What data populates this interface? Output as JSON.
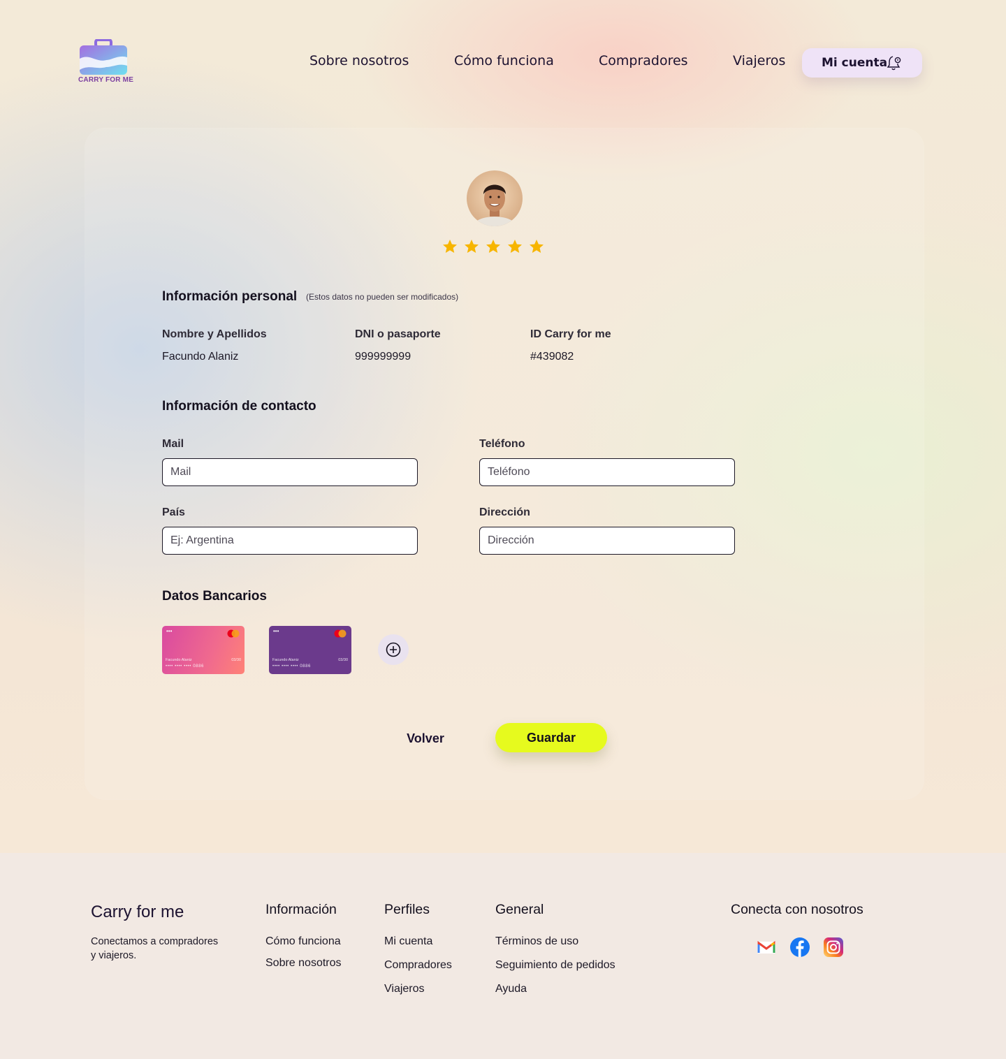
{
  "header": {
    "logo_text": "CARRY FOR ME",
    "nav": [
      "Sobre nosotros",
      "Cómo funciona",
      "Compradores",
      "Viajeros"
    ],
    "account_label": "Mi cuenta"
  },
  "profile": {
    "rating_stars": 5,
    "personal": {
      "title": "Información personal",
      "note": "(Estos datos no pueden ser modificados)",
      "fields": [
        {
          "label": "Nombre y Apellidos",
          "value": "Facundo Alaniz"
        },
        {
          "label": "DNI o pasaporte",
          "value": "999999999"
        },
        {
          "label": "ID Carry for me",
          "value": "#439082"
        }
      ]
    },
    "contact": {
      "title": "Información de contacto",
      "mail": {
        "label": "Mail",
        "placeholder": "Mail"
      },
      "phone": {
        "label": "Teléfono",
        "placeholder": "Teléfono"
      },
      "country": {
        "label": "País",
        "placeholder": "Ej: Argentina"
      },
      "address": {
        "label": "Dirección",
        "placeholder": "Dirección"
      }
    },
    "bank": {
      "title": "Datos Bancarios",
      "cards": [
        {
          "dots": "•••",
          "holder": "Facundo Alaniz",
          "expiry": "03/30",
          "number": "•••• •••• •••• 0886",
          "color": "#ee5d92"
        },
        {
          "dots": "•••",
          "holder": "Facundo Alaniz",
          "expiry": "03/30",
          "number": "•••• •••• •••• 0886",
          "color": "#6b3a8c"
        }
      ]
    },
    "actions": {
      "back": "Volver",
      "save": "Guardar"
    }
  },
  "footer": {
    "brand": "Carry for me",
    "tagline": "Conectamos a compradores y viajeros.",
    "info": {
      "title": "Información",
      "links": [
        "Cómo funciona",
        "Sobre nosotros"
      ]
    },
    "profiles": {
      "title": "Perfiles",
      "links": [
        "Mi cuenta",
        "Compradores",
        "Viajeros"
      ]
    },
    "general": {
      "title": "General",
      "links": [
        "Términos de uso",
        "Seguimiento de pedidos",
        "Ayuda"
      ]
    },
    "connect": {
      "title": "Conecta con nosotros",
      "icons": [
        "gmail-icon",
        "facebook-icon",
        "instagram-icon"
      ]
    }
  },
  "colors": {
    "accent": "#e6fa1e",
    "star": "#f7b500",
    "account_bg": "#efe3f7"
  }
}
